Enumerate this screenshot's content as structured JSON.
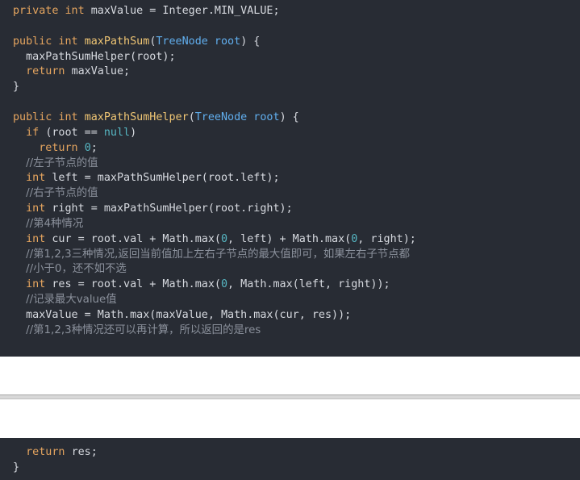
{
  "code_top": {
    "lines": [
      [
        [
          "private int ",
          "kw"
        ],
        [
          "maxValue = Integer.MIN_VALUE;",
          "txt"
        ]
      ],
      [],
      [
        [
          "public int ",
          "kw"
        ],
        [
          "maxPathSum",
          "fn"
        ],
        [
          "(",
          "txt"
        ],
        [
          "TreeNode root",
          "cls"
        ],
        [
          ") {",
          "txt"
        ]
      ],
      [
        [
          "  maxPathSumHelper(root);",
          "txt"
        ]
      ],
      [
        [
          "  ",
          "txt"
        ],
        [
          "return ",
          "kw"
        ],
        [
          "maxValue;",
          "txt"
        ]
      ],
      [
        [
          "}",
          "txt"
        ]
      ],
      [],
      [
        [
          "public int ",
          "kw"
        ],
        [
          "maxPathSumHelper",
          "fn"
        ],
        [
          "(",
          "txt"
        ],
        [
          "TreeNode root",
          "cls"
        ],
        [
          ") {",
          "txt"
        ]
      ],
      [
        [
          "  ",
          "txt"
        ],
        [
          "if ",
          "kw"
        ],
        [
          "(root == ",
          "txt"
        ],
        [
          "null",
          "num"
        ],
        [
          ")",
          "txt"
        ]
      ],
      [
        [
          "    ",
          "txt"
        ],
        [
          "return ",
          "kw"
        ],
        [
          "0",
          "num"
        ],
        [
          ";",
          "txt"
        ]
      ],
      [
        [
          "  ",
          "txt"
        ],
        [
          "//左子节点的值",
          "com"
        ]
      ],
      [
        [
          "  ",
          "txt"
        ],
        [
          "int ",
          "kw"
        ],
        [
          "left = maxPathSumHelper(root.left);",
          "txt"
        ]
      ],
      [
        [
          "  ",
          "txt"
        ],
        [
          "//右子节点的值",
          "com"
        ]
      ],
      [
        [
          "  ",
          "txt"
        ],
        [
          "int ",
          "kw"
        ],
        [
          "right = maxPathSumHelper(root.right);",
          "txt"
        ]
      ],
      [
        [
          "  ",
          "txt"
        ],
        [
          "//第4种情况",
          "com"
        ]
      ],
      [
        [
          "  ",
          "txt"
        ],
        [
          "int ",
          "kw"
        ],
        [
          "cur = root.val + Math.max(",
          "txt"
        ],
        [
          "0",
          "num"
        ],
        [
          ", left) + Math.max(",
          "txt"
        ],
        [
          "0",
          "num"
        ],
        [
          ", right);",
          "txt"
        ]
      ],
      [
        [
          "  ",
          "txt"
        ],
        [
          "//第1,2,3三种情况,返回当前值加上左右子节点的最大值即可，如果左右子节点都",
          "com"
        ]
      ],
      [
        [
          "  ",
          "txt"
        ],
        [
          "//小于0，还不如不选",
          "com"
        ]
      ],
      [
        [
          "  ",
          "txt"
        ],
        [
          "int ",
          "kw"
        ],
        [
          "res = root.val + Math.max(",
          "txt"
        ],
        [
          "0",
          "num"
        ],
        [
          ", Math.max(left, right));",
          "txt"
        ]
      ],
      [
        [
          "  ",
          "txt"
        ],
        [
          "//记录最大value值",
          "com"
        ]
      ],
      [
        [
          "  maxValue = Math.max(maxValue, Math.max(cur, res));",
          "txt"
        ]
      ],
      [
        [
          "  ",
          "txt"
        ],
        [
          "//第1,2,3种情况还可以再计算，所以返回的是res",
          "com"
        ]
      ]
    ]
  },
  "code_bottom": {
    "lines": [
      [
        [
          "  ",
          "txt"
        ],
        [
          "return ",
          "kw"
        ],
        [
          "res;",
          "txt"
        ]
      ],
      [
        [
          "}",
          "txt"
        ]
      ]
    ]
  },
  "colors": {
    "background": "#282c34",
    "keyword": "#e5a55f",
    "function": "#f0c674",
    "class": "#61afef",
    "number": "#56b6c2",
    "comment": "#8b919c",
    "text": "#d7dae0"
  }
}
